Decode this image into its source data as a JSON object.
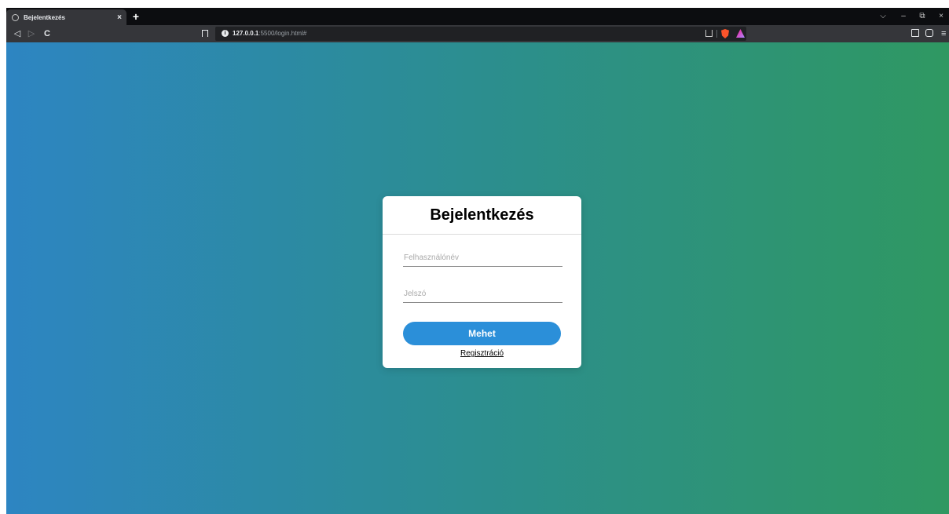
{
  "browser": {
    "tab": {
      "title": "Bejelentkezés",
      "close_glyph": "×"
    },
    "new_tab_glyph": "+",
    "window_controls": {
      "dropdown": "⌵",
      "minimize": "–",
      "restore": "⧉",
      "close": "×"
    },
    "nav": {
      "back": "◁",
      "forward": "▷",
      "reload": "C"
    },
    "url": {
      "host": "127.0.0.1",
      "path": ":5500/login.html#"
    },
    "menu_glyph": "≡"
  },
  "login": {
    "title": "Bejelentkezés",
    "username_placeholder": "Felhasználónév",
    "password_placeholder": "Jelszó",
    "submit_label": "Mehet",
    "register_link": "Regisztráció"
  },
  "colors": {
    "gradient_left": "#2d85c2",
    "gradient_right": "#2f9862",
    "button": "#2b8fd9"
  }
}
